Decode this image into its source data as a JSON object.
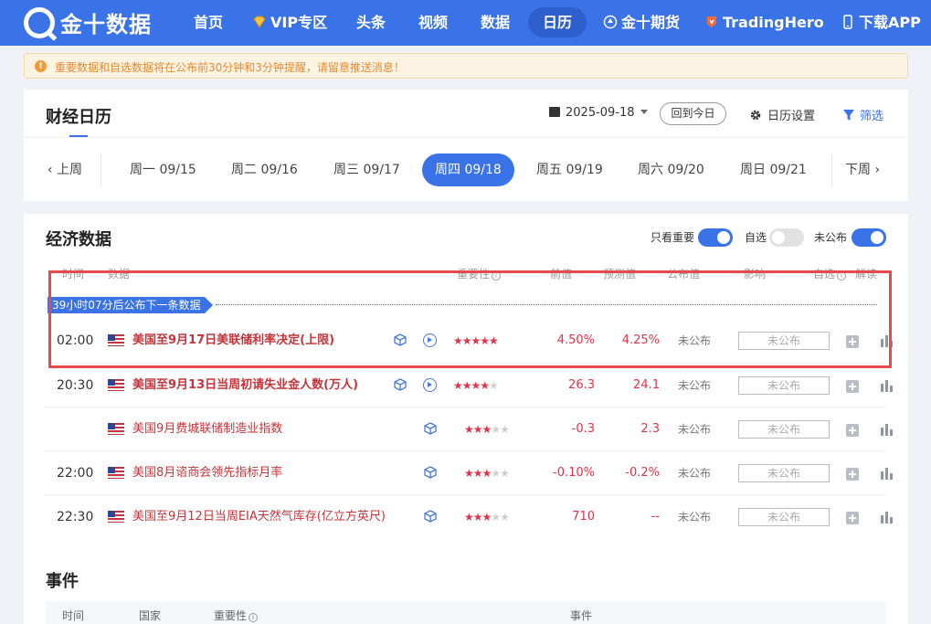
{
  "nav": {
    "logo_text": "金十数据",
    "items": [
      {
        "label": "首页"
      },
      {
        "label": "VIP专区"
      },
      {
        "label": "头条"
      },
      {
        "label": "视频"
      },
      {
        "label": "数据"
      },
      {
        "label": "日历"
      },
      {
        "label": "金十期货"
      },
      {
        "label": "TradingHero"
      },
      {
        "label": "下载APP"
      }
    ]
  },
  "notice": {
    "icon": "!",
    "text": "重要数据和自选数据将在公布前30分钟和3分钟提醒，请留意推送消息！"
  },
  "calendar": {
    "title": "财经日历",
    "date": "2025-09-18",
    "today_label": "回到今日",
    "settings_label": "日历设置",
    "filter_label": "筛选",
    "prev_week": "上周",
    "next_week": "下周",
    "days": [
      {
        "label": "周一 09/15"
      },
      {
        "label": "周二 09/16"
      },
      {
        "label": "周三 09/17"
      },
      {
        "label": "周四 09/18"
      },
      {
        "label": "周五 09/19"
      },
      {
        "label": "周六 09/20"
      },
      {
        "label": "周日 09/21"
      }
    ],
    "active_day": "周四 09/18"
  },
  "econ": {
    "title": "经济数据",
    "toggles": [
      {
        "label": "只看重要",
        "on": true
      },
      {
        "label": "自选",
        "on": false
      },
      {
        "label": "未公布",
        "on": true
      }
    ],
    "headers": {
      "time": "时间",
      "data": "数据",
      "importance": "重要性",
      "prev": "前值",
      "forecast": "预测值",
      "actual": "公布值",
      "impact": "影响",
      "watch": "自选",
      "analysis": "解读"
    },
    "countdown": "39小时07分后公布下一条数据",
    "rows": [
      {
        "time": "02:00",
        "title": "美国至9月17日美联储利率决定(上限)",
        "stars": 5,
        "prev": "4.50%",
        "forecast": "4.25%",
        "actual": "未公布",
        "input_placeholder": "未公布"
      },
      {
        "time": "20:30",
        "title": "美国至9月13日当周初请失业金人数(万人)",
        "stars": 4,
        "prev": "26.3",
        "forecast": "24.1",
        "actual": "未公布",
        "input_placeholder": "未公布"
      },
      {
        "time": "",
        "title": "美国9月费城联储制造业指数",
        "stars": 3,
        "prev": "-0.3",
        "forecast": "2.3",
        "actual": "未公布",
        "input_placeholder": "未公布"
      },
      {
        "time": "22:00",
        "title": "美国8月谘商会领先指标月率",
        "stars": 3,
        "prev": "-0.10%",
        "forecast": "-0.2%",
        "actual": "未公布",
        "input_placeholder": "未公布"
      },
      {
        "time": "22:30",
        "title": "美国至9月12日当周EIA天然气库存(亿立方英尺)",
        "stars": 3,
        "prev": "710",
        "forecast": "--",
        "actual": "未公布",
        "input_placeholder": "未公布"
      }
    ]
  },
  "events": {
    "title": "事件",
    "headers": {
      "time": "时间",
      "country": "国家",
      "importance": "重要性",
      "event": "事件"
    }
  },
  "colors": {
    "brand": "#3a72e8",
    "accent_red": "#e0334a",
    "highlight_red": "#e74a4a"
  }
}
